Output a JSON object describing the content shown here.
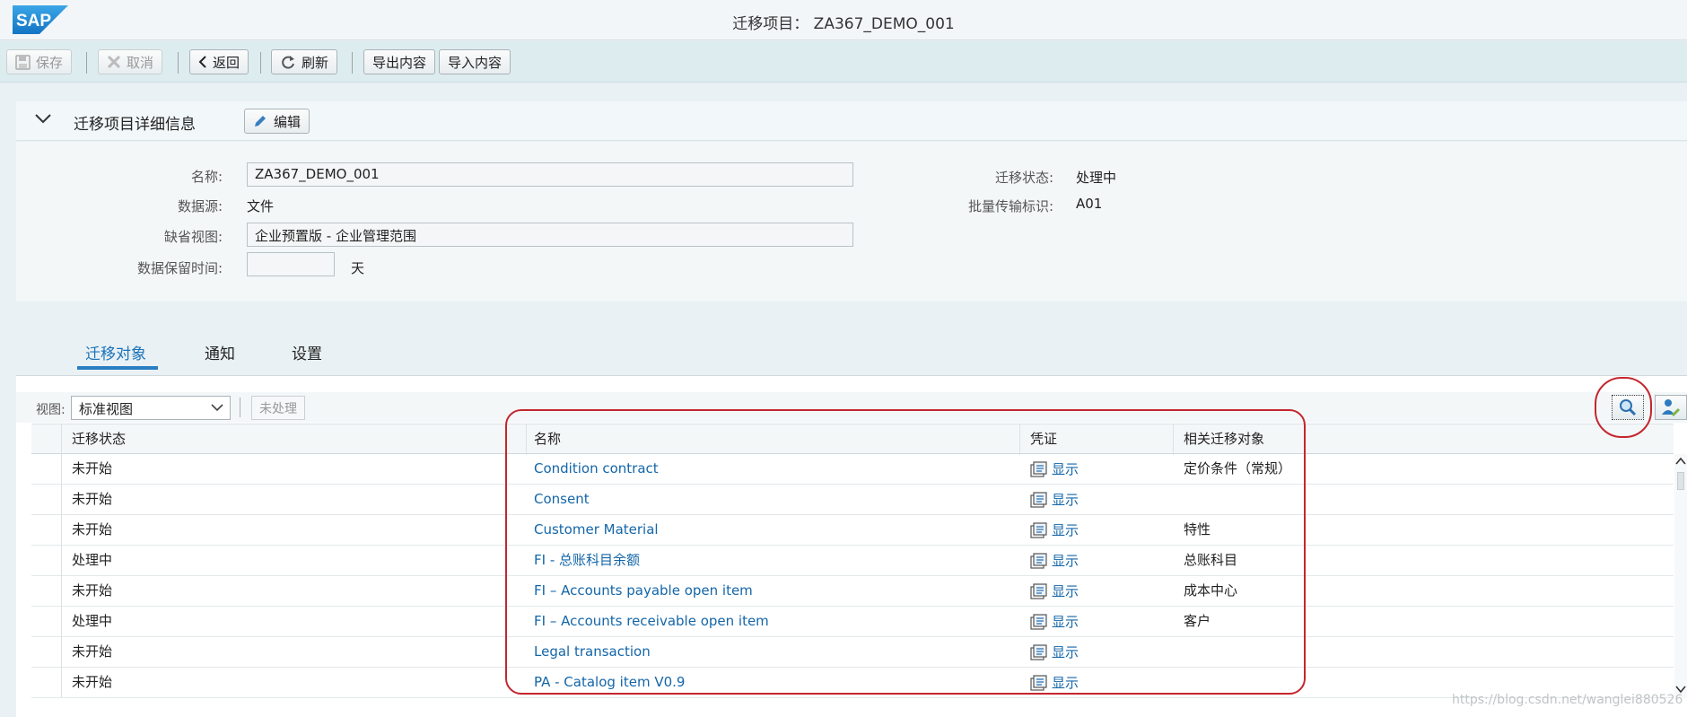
{
  "window": {
    "title": "迁移项目： ZA367_DEMO_001"
  },
  "toolbar": {
    "save": "保存",
    "cancel": "取消",
    "back": "返回",
    "refresh": "刷新",
    "export": "导出内容",
    "import": "导入内容"
  },
  "details": {
    "title": "迁移项目详细信息",
    "edit": "编辑",
    "name_label": "名称:",
    "name_value": "ZA367_DEMO_001",
    "source_label": "数据源:",
    "source_value": "文件",
    "view_label": "缺省视图:",
    "view_value": "企业预置版 - 企业管理范围",
    "retention_label": "数据保留时间:",
    "retention_value": "",
    "retention_unit": "天",
    "status_label": "迁移状态:",
    "status_value": "处理中",
    "mass_label": "批量传输标识:",
    "mass_value": "A01"
  },
  "tabs": [
    "迁移对象",
    "通知",
    "设置"
  ],
  "table_toolbar": {
    "view_label": "视图:",
    "view_value": "标准视图",
    "unprocessed": "未处理"
  },
  "table": {
    "columns": [
      "迁移状态",
      "名称",
      "凭证",
      "相关迁移对象"
    ],
    "rows": [
      {
        "status": "未开始",
        "name": "Condition contract",
        "doc": "显示",
        "related": "定价条件（常规）"
      },
      {
        "status": "未开始",
        "name": "Consent",
        "doc": "显示",
        "related": ""
      },
      {
        "status": "未开始",
        "name": "Customer Material",
        "doc": "显示",
        "related": "特性"
      },
      {
        "status": "处理中",
        "name": "FI - 总账科目余额",
        "doc": "显示",
        "related": "总账科目"
      },
      {
        "status": "未开始",
        "name": "FI – Accounts payable open item",
        "doc": "显示",
        "related": "成本中心"
      },
      {
        "status": "处理中",
        "name": "FI – Accounts receivable open item",
        "doc": "显示",
        "related": "客户"
      },
      {
        "status": "未开始",
        "name": "Legal transaction",
        "doc": "显示",
        "related": ""
      },
      {
        "status": "未开始",
        "name": "PA - Catalog item V0.9",
        "doc": "显示",
        "related": ""
      }
    ]
  },
  "watermark": "https://blog.csdn.net/wanglei880526",
  "colors": {
    "accent": "#1a73ba",
    "annotation": "#c4262e",
    "sap_blue": "#1e8fd6"
  }
}
